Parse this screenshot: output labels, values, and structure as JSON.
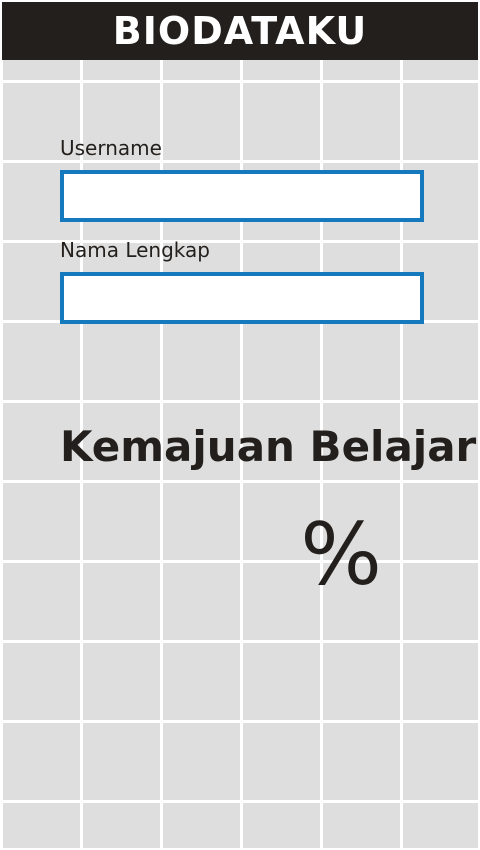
{
  "header": {
    "title": "BIODATAKU"
  },
  "form": {
    "username": {
      "label": "Username",
      "value": ""
    },
    "full_name": {
      "label": "Nama Lengkap",
      "value": ""
    }
  },
  "progress": {
    "heading": "Kemajuan Belajar",
    "value": "",
    "unit": "%"
  },
  "colors": {
    "header_bg": "#231f1c",
    "input_border": "#1479bd",
    "background": "#dedede",
    "grid_lines": "#ffffff",
    "text": "#231f1c"
  }
}
